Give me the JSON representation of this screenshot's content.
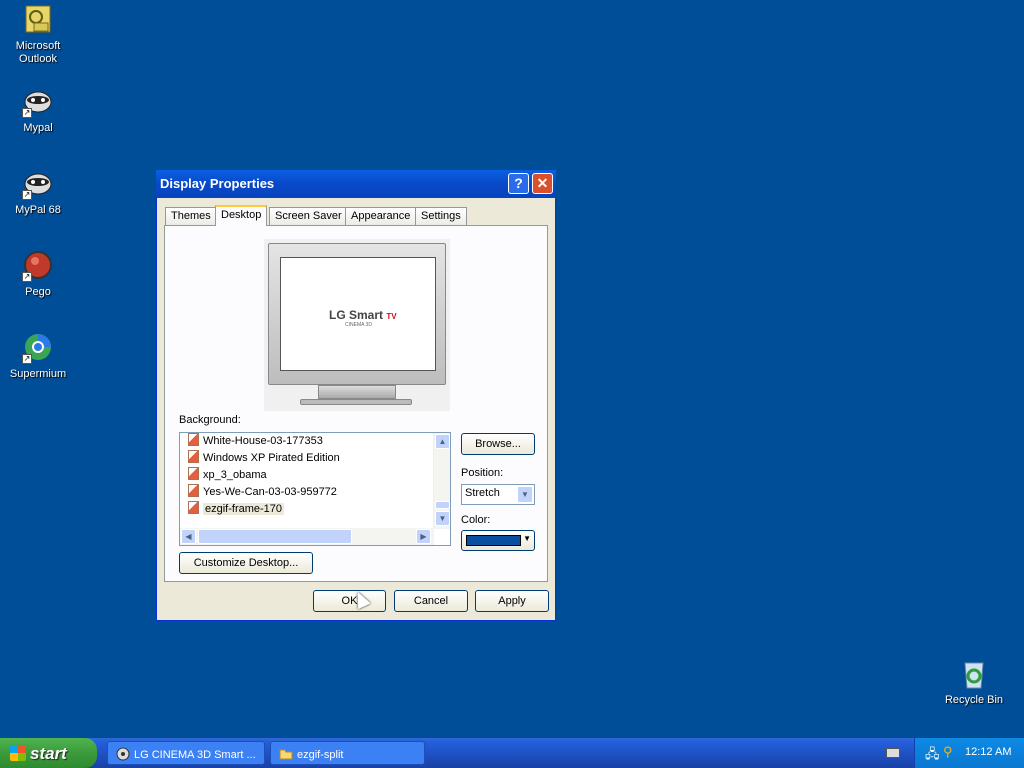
{
  "desktop": {
    "icons": [
      {
        "label": "Microsoft\nOutlook",
        "icon": "outlook-icon"
      },
      {
        "label": "Mypal",
        "icon": "mypal-icon"
      },
      {
        "label": "MyPal 68",
        "icon": "mypal68-icon"
      },
      {
        "label": "Pego",
        "icon": "pego-icon"
      },
      {
        "label": "Supermium",
        "icon": "supermium-icon"
      },
      {
        "label": "Recycle Bin",
        "icon": "recycle-bin-icon"
      }
    ]
  },
  "window": {
    "title": "Display Properties",
    "help": "?",
    "close": "✕",
    "tabs": [
      "Themes",
      "Desktop",
      "Screen Saver",
      "Appearance",
      "Settings"
    ],
    "active_tab": "Desktop",
    "preview_logo": {
      "brand": "LG Smart",
      "badge": "TV",
      "sub": "CINEMA 3D"
    },
    "background_label": "Background:",
    "background_items": [
      "White-House-03-177353",
      "Windows XP Pirated Edition",
      "xp_3_obama",
      "Yes-We-Can-03-03-959772",
      "ezgif-frame-170"
    ],
    "selected_background": "ezgif-frame-170",
    "browse_label": "Browse...",
    "position_label": "Position:",
    "position_value": "Stretch",
    "color_label": "Color:",
    "color_value": "#0a4ea0",
    "customize_label": "Customize Desktop...",
    "ok_label": "OK",
    "cancel_label": "Cancel",
    "apply_label": "Apply"
  },
  "taskbar": {
    "start_label": "start",
    "tasks": [
      {
        "label": "LG CINEMA 3D Smart ...",
        "icon": "browser-icon"
      },
      {
        "label": "ezgif-split",
        "icon": "folder-icon"
      }
    ],
    "clock": "12:12 AM"
  },
  "colors": {
    "desktop_bg": "#004e98",
    "title_bar": "#0849c8",
    "taskbar": "#245edb",
    "start_button": "#3c9b3c"
  }
}
